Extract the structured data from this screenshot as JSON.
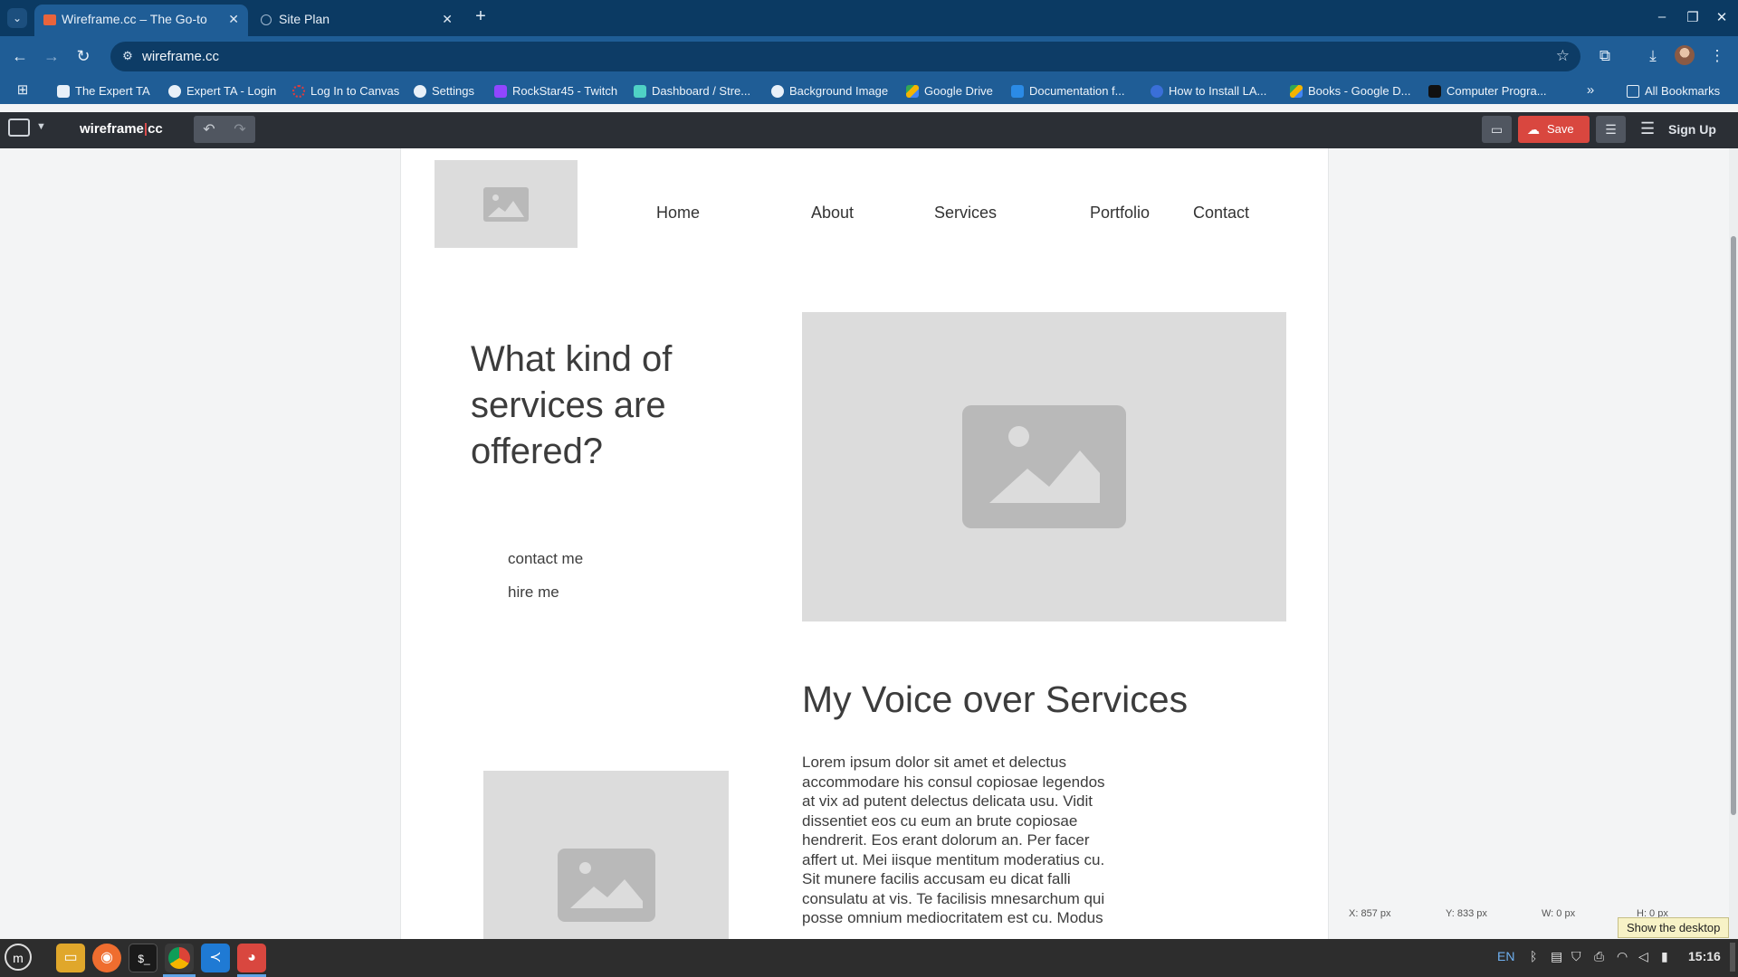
{
  "browser": {
    "tabs": [
      {
        "title": "Wireframe.cc – The Go-to Fr",
        "active": true
      },
      {
        "title": "Site Plan",
        "active": false
      }
    ],
    "url": "wireframe.cc",
    "bookmarks": [
      {
        "label": "The Expert TA",
        "color": "#ffffff"
      },
      {
        "label": "Expert TA - Login",
        "color": "#ffffff"
      },
      {
        "label": "Log In to Canvas",
        "color": "#e23c3c"
      },
      {
        "label": "Settings",
        "color": "#ffffff"
      },
      {
        "label": "RockStar45 - Twitch",
        "color": "#9146ff"
      },
      {
        "label": "Dashboard / Stre...",
        "color": "#4fd1c5"
      },
      {
        "label": "Background Image",
        "color": "#ffffff"
      },
      {
        "label": "Google Drive",
        "color": "#f4b400"
      },
      {
        "label": "Documentation f...",
        "color": "#2b8be6"
      },
      {
        "label": "How to Install LA...",
        "color": "#3a6fd8"
      },
      {
        "label": "Books - Google D...",
        "color": "#f4b400"
      },
      {
        "label": "Computer Progra...",
        "color": "#111111"
      }
    ],
    "all_bookmarks": "All Bookmarks"
  },
  "app": {
    "brand_left": "wireframe",
    "brand_pipe": "|",
    "brand_right": "cc",
    "save_label": "Save",
    "signup_label": "Sign Up"
  },
  "wireframe": {
    "nav": [
      "Home",
      "About",
      "Services",
      "Portfolio",
      "Contact"
    ],
    "hero_title": "What kind of services are offered?",
    "hero_links": [
      "contact me",
      "hire me"
    ],
    "section_title": "My Voice over Services",
    "body_text": "Lorem ipsum dolor sit amet et delectus accommodare his consul copiosae legendos at vix ad putent delectus delicata usu. Vidit dissentiet eos cu eum an brute copiosae hendrerit. Eos erant dolorum an. Per facer affert ut. Mei iisque mentitum moderatius cu. Sit munere facilis accusam eu dicat falli consulatu at vis. Te facilisis mnesarchum qui posse omnium mediocritatem est cu. Modus"
  },
  "status": {
    "x": "X: 857 px",
    "y": "Y: 833 px",
    "w": "W: 0 px",
    "h": "H: 0 px"
  },
  "tooltip": "Show the desktop",
  "taskbar": {
    "lang": "EN",
    "time": "15:16"
  },
  "colors": {
    "accent_save": "#d9473f",
    "chrome_blue": "#1f5d96",
    "appbar_dark": "#2b2f35"
  }
}
